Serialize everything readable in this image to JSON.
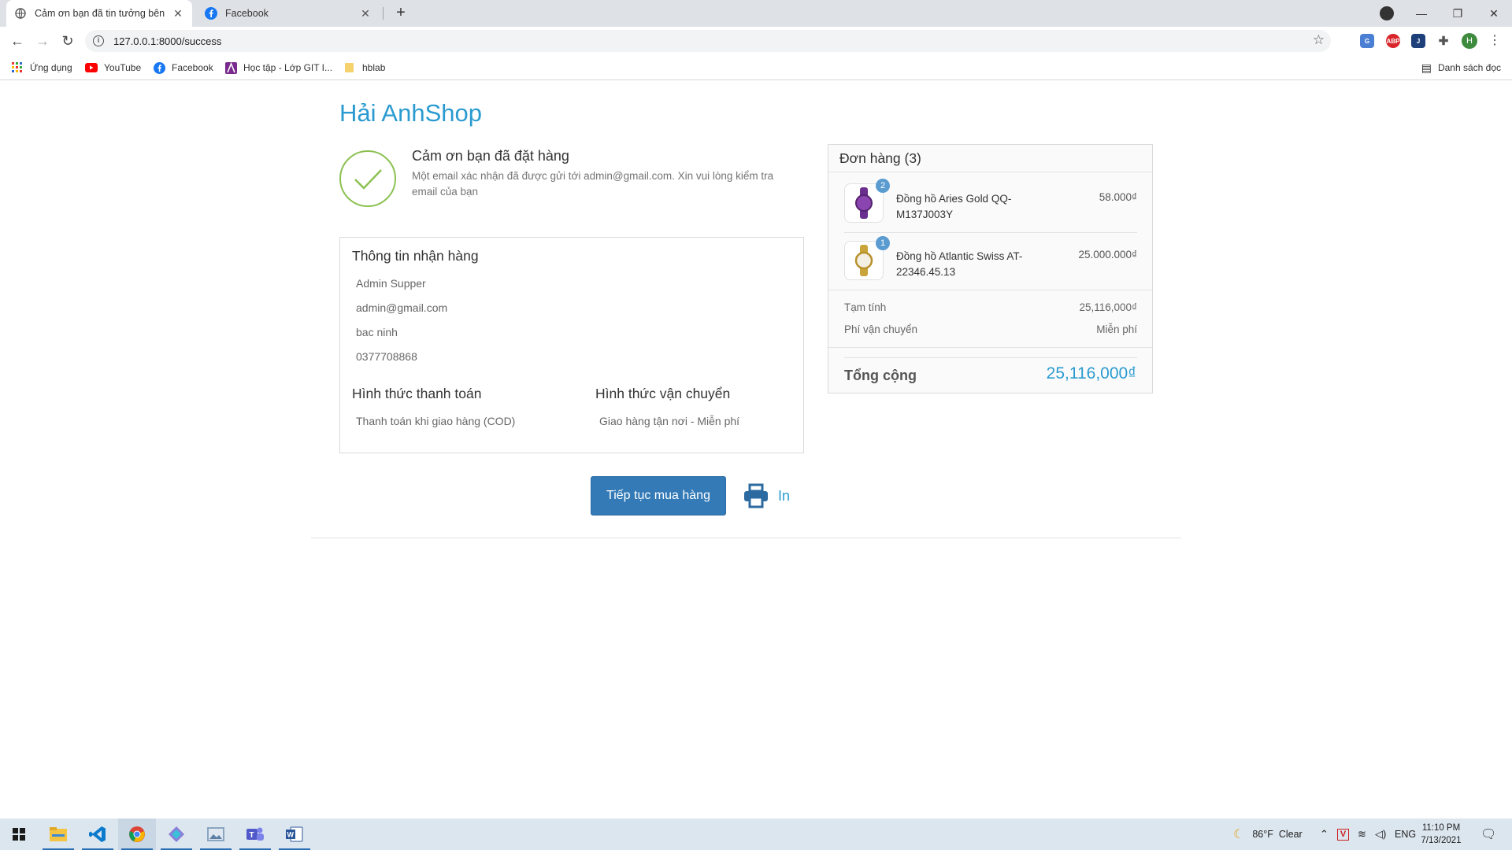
{
  "browser": {
    "tabs": [
      {
        "title": "Cảm ơn bạn đã tin tưởng bên mình",
        "active": true
      },
      {
        "title": "Facebook",
        "active": false
      }
    ],
    "url": "127.0.0.1:8000/success",
    "bookmarks": [
      {
        "label": "Ứng dụng",
        "icon": "apps-grid-icon"
      },
      {
        "label": "YouTube",
        "icon": "youtube-icon"
      },
      {
        "label": "Facebook",
        "icon": "facebook-icon"
      },
      {
        "label": "Học tập - Lớp GIT I...",
        "icon": "bookmark-a-icon"
      },
      {
        "label": "hblab",
        "icon": "folder-icon"
      }
    ],
    "reading_list": "Danh sách đọc",
    "profile_initial": "H",
    "extensions": [
      "translate-icon",
      "abp-icon",
      "j-icon",
      "puzzle-icon"
    ]
  },
  "shop": {
    "name": "Hải AnhShop",
    "thanks_title": "Cảm ơn bạn đã đặt hàng",
    "thanks_message": "Một email xác nhận đã được gửi tới admin@gmail.com. Xin vui lòng kiểm tra email của bạn"
  },
  "shipping_info": {
    "title": "Thông tin nhận hàng",
    "name": "Admin Supper",
    "email": "admin@gmail.com",
    "address": "bac ninh",
    "phone": "0377708868",
    "payment_title": "Hình thức thanh toán",
    "payment_value": "Thanh toán khi giao hàng (COD)",
    "delivery_title": "Hình thức vận chuyển",
    "delivery_value": "Giao hàng tận nơi - Miễn phí"
  },
  "order": {
    "title": "Đơn hàng (3)",
    "items": [
      {
        "name": "Đồng hồ Aries Gold QQ-M137J003Y",
        "qty": "2",
        "price": "58.000₫",
        "thumb_color": "#7b3fa0"
      },
      {
        "name": "Đồng hồ Atlantic Swiss AT-22346.45.13",
        "qty": "1",
        "price": "25.000.000₫",
        "thumb_color": "#c9a43a"
      }
    ],
    "subtotal_label": "Tạm tính",
    "subtotal_value": "25,116,000₫",
    "shipping_label": "Phí vận chuyển",
    "shipping_value": "Miễn phí",
    "total_label": "Tổng cộng",
    "total_value": "25,116,000₫"
  },
  "actions": {
    "continue_label": "Tiếp tục mua hàng",
    "print_label": "In"
  },
  "taskbar": {
    "apps": [
      "windows-start-icon",
      "file-explorer-icon",
      "vscode-icon",
      "chrome-icon",
      "sourcetree-icon",
      "image-viewer-icon",
      "teams-icon",
      "word-icon"
    ],
    "weather": "86°F  Clear",
    "language": "ENG",
    "time": "11:10 PM",
    "date": "7/13/2021"
  },
  "colors": {
    "brand": "#2a9bd0",
    "button": "#337ab7",
    "success": "#8cc152"
  }
}
